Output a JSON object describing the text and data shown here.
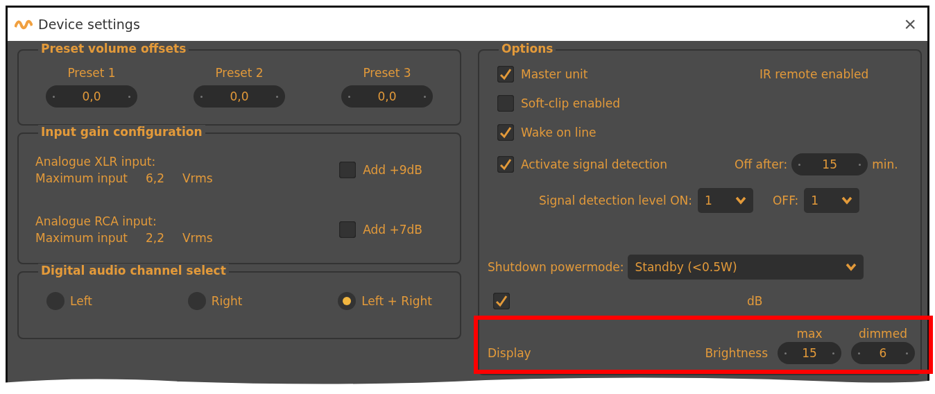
{
  "window": {
    "title": "Device settings",
    "close": "×"
  },
  "preset_volume_offsets": {
    "title": "Preset volume offsets",
    "presets": [
      {
        "label": "Preset 1",
        "value": "0,0"
      },
      {
        "label": "Preset 2",
        "value": "0,0"
      },
      {
        "label": "Preset 3",
        "value": "0,0"
      }
    ]
  },
  "input_gain": {
    "title": "Input gain configuration",
    "inputs": [
      {
        "name": "Analogue XLR input:",
        "max_label": "Maximum input",
        "max_value": "6,2",
        "unit": "Vrms",
        "add_label": "Add +9dB",
        "checked": false
      },
      {
        "name": "Analogue RCA input:",
        "max_label": "Maximum input",
        "max_value": "2,2",
        "unit": "Vrms",
        "add_label": "Add +7dB",
        "checked": false
      }
    ]
  },
  "digital_channel": {
    "title": "Digital audio channel select",
    "options": [
      {
        "label": "Left",
        "selected": false
      },
      {
        "label": "Right",
        "selected": false
      },
      {
        "label": "Left + Right",
        "selected": true
      }
    ]
  },
  "options": {
    "title": "Options",
    "checkboxes": [
      {
        "label": "Master unit",
        "checked": true
      },
      {
        "label": "Soft-clip enabled",
        "checked": false
      },
      {
        "label": "Wake on line",
        "checked": true
      },
      {
        "label": "Activate signal detection",
        "checked": true
      }
    ],
    "ir_remote": "IR remote enabled",
    "off_after_label": "Off after:",
    "off_after_value": "15",
    "off_after_unit": "min.",
    "level_on_label": "Signal detection level ON:",
    "level_on_value": "1",
    "level_off_label": "OFF:",
    "level_off_value": "1",
    "shutdown_label": "Shutdown powermode:",
    "shutdown_value": "Standby (<0.5W)",
    "volume_on_start": {
      "checked": true,
      "unit": "dB"
    },
    "display": {
      "label": "Display",
      "brightness_label": "Brightness",
      "max_label": "max",
      "max_value": "15",
      "dimmed_label": "dimmed",
      "dimmed_value": "6"
    }
  }
}
